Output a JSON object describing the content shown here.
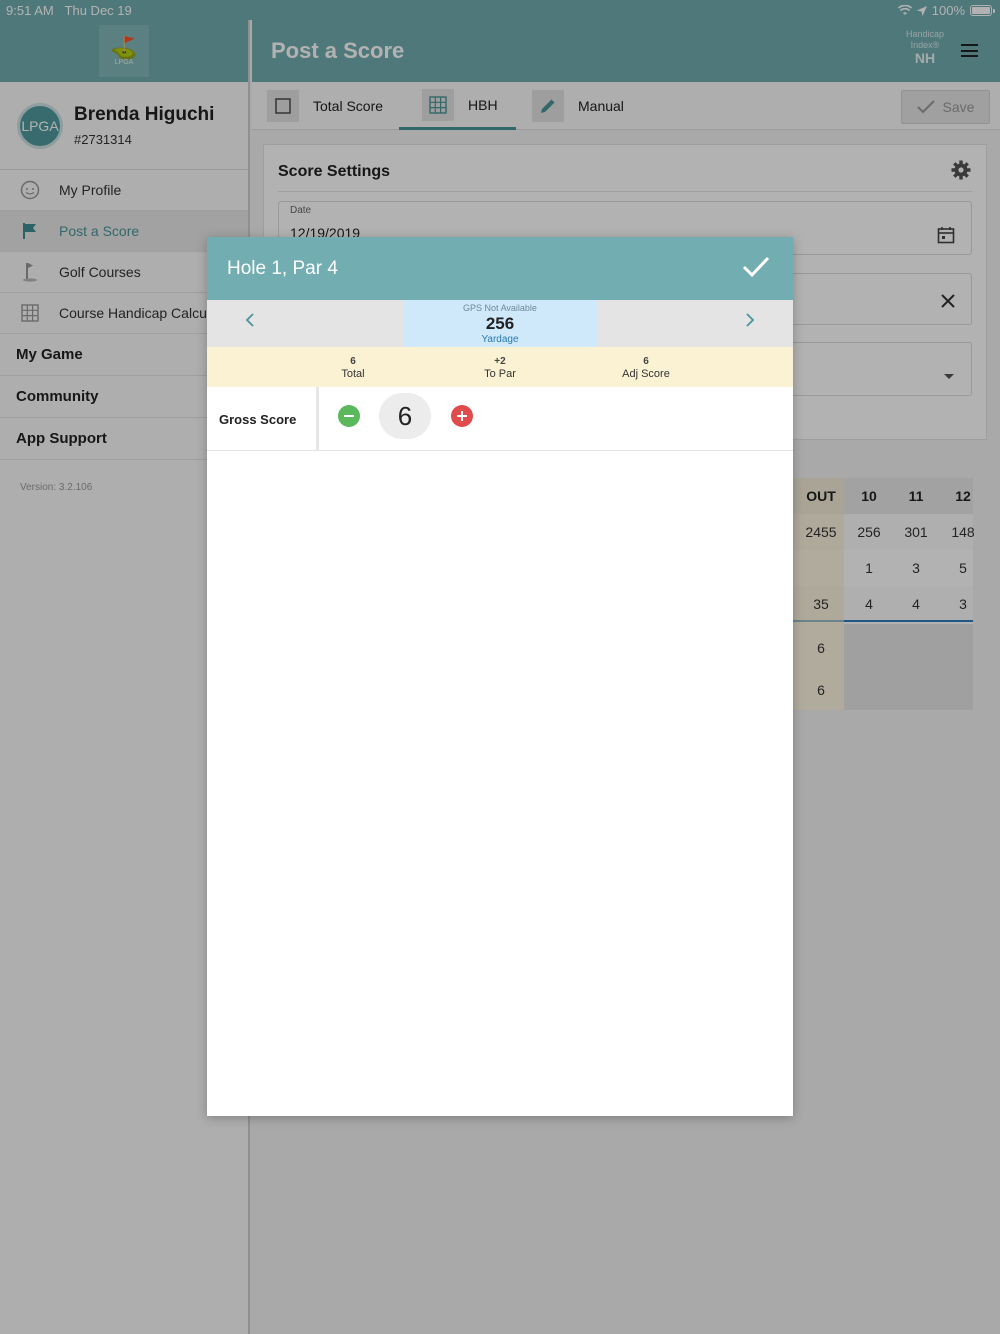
{
  "status_bar": {
    "time": "9:51 AM",
    "date": "Thu Dec 19",
    "battery": "100%"
  },
  "sidebar": {
    "logo_text": "LPGA",
    "user": {
      "name": "Brenda Higuchi",
      "id": "#2731314"
    },
    "items": [
      {
        "label": "My Profile",
        "icon": "face-icon"
      },
      {
        "label": "Post a Score",
        "icon": "flag-icon",
        "active": true
      },
      {
        "label": "Golf Courses",
        "icon": "golf-pin-icon"
      },
      {
        "label": "Course Handicap Calcul",
        "icon": "grid-icon"
      }
    ],
    "sections": [
      "My Game",
      "Community",
      "App Support"
    ],
    "version": "Version: 3.2.106"
  },
  "header": {
    "title": "Post a Score",
    "handicap_line1": "Handicap",
    "handicap_line2": "Index®",
    "handicap_value": "NH"
  },
  "tabs": [
    {
      "label": "Total Score",
      "icon": "checkbox-icon"
    },
    {
      "label": "HBH",
      "icon": "grid-icon",
      "active": true
    },
    {
      "label": "Manual",
      "icon": "pencil-icon"
    }
  ],
  "save_label": "Save",
  "score_settings": {
    "title": "Score Settings",
    "date_label": "Date",
    "date_value": "12/19/2019"
  },
  "scorecard": {
    "headers": [
      "OUT",
      "10",
      "11",
      "12"
    ],
    "yardage": [
      "2455",
      "256",
      "301",
      "148"
    ],
    "handicap": [
      "",
      "1",
      "3",
      "5"
    ],
    "par": [
      "35",
      "4",
      "4",
      "3"
    ],
    "score_rows": [
      [
        "6",
        "",
        "",
        ""
      ],
      [
        "6",
        "",
        "",
        ""
      ]
    ]
  },
  "modal": {
    "title": "Hole 1, Par 4",
    "gps_text": "GPS Not Available",
    "yardage": "256",
    "yardage_label": "Yardage",
    "stats": [
      {
        "value": "6",
        "label": "Total"
      },
      {
        "value": "+2",
        "label": "To Par"
      },
      {
        "value": "6",
        "label": "Adj Score"
      }
    ],
    "gross_label": "Gross Score",
    "gross_value": "6"
  },
  "colors": {
    "accent": "#72adb1",
    "accent_dark": "#4a9599",
    "yardage_bg": "#cfe9fb",
    "stats_bg": "#fbf2d4",
    "minus": "#5cb85c",
    "plus": "#e04b4b"
  }
}
